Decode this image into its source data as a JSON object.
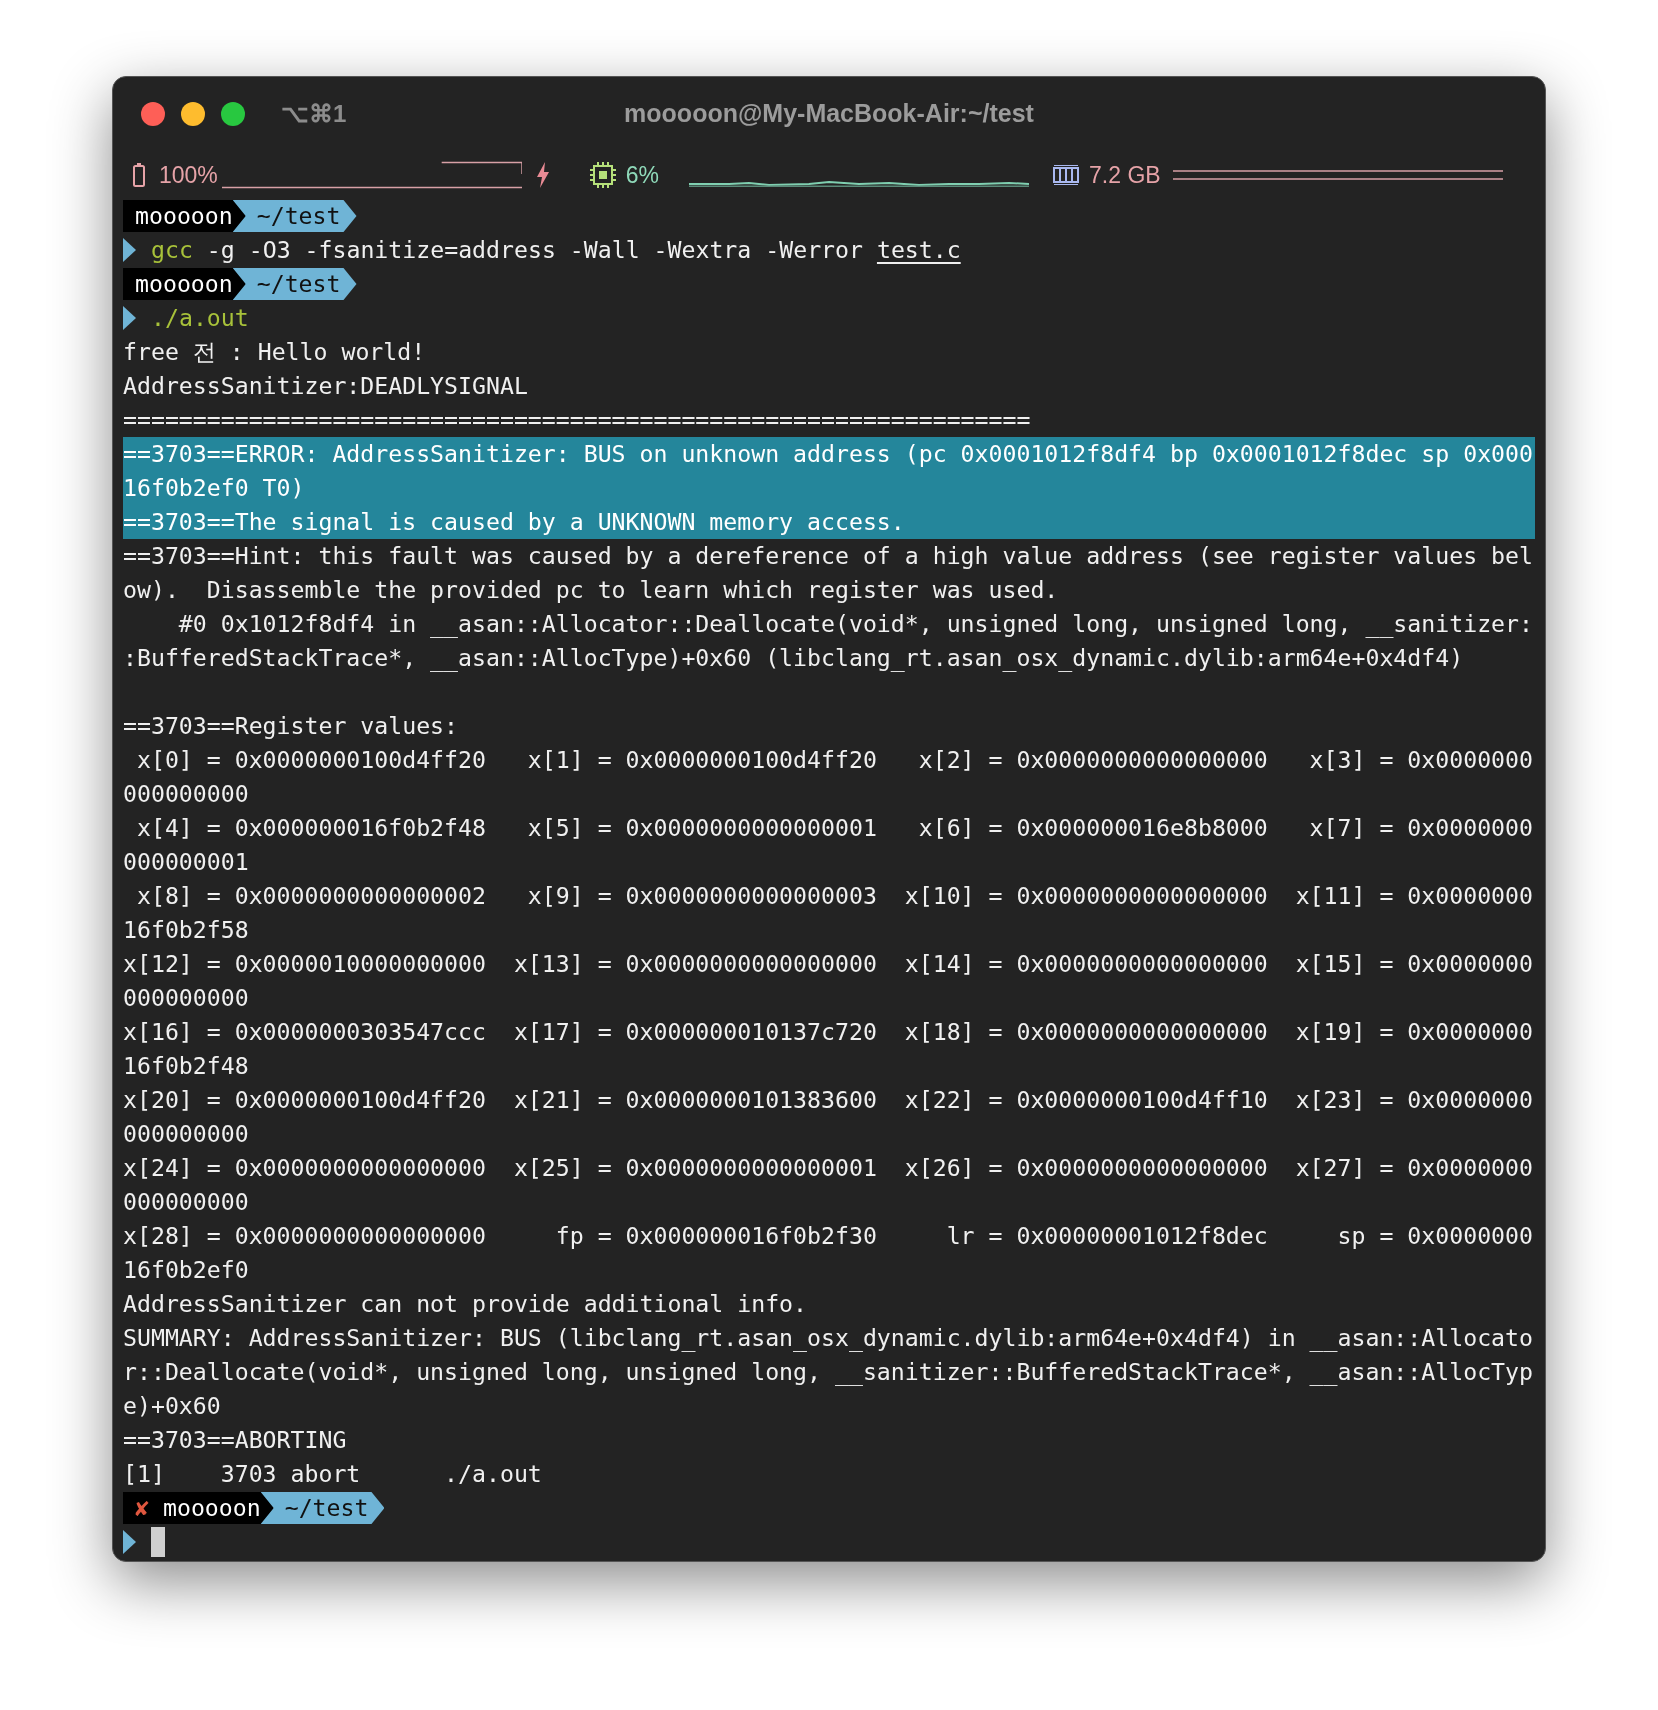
{
  "window": {
    "title": "mooooon@My-MacBook-Air:~/test",
    "shortcut": "⌥⌘1"
  },
  "status_bar": {
    "battery": "100%",
    "cpu": "6%",
    "memory": "7.2 GB"
  },
  "lines": [
    {
      "kind": "prompt",
      "user": "mooooon",
      "path": "~/test"
    },
    {
      "kind": "command",
      "parts": [
        {
          "kind": "program",
          "text": "gcc"
        },
        {
          "kind": "arg",
          "text": " -g -O3 -fsanitize=address -Wall -Wextra -Werror "
        },
        {
          "kind": "file",
          "text": "test.c"
        }
      ]
    },
    {
      "kind": "prompt",
      "user": "mooooon",
      "path": "~/test"
    },
    {
      "kind": "command",
      "parts": [
        {
          "kind": "program",
          "text": "./a.out"
        }
      ]
    },
    {
      "kind": "output",
      "text": "free 전 : Hello world!",
      "selected": false
    },
    {
      "kind": "output",
      "text": "AddressSanitizer:DEADLYSIGNAL",
      "selected": false
    },
    {
      "kind": "output",
      "text": "=================================================================",
      "selected": false
    },
    {
      "kind": "output",
      "text": "==3703==ERROR: AddressSanitizer: BUS on unknown address (pc 0x0001012f8df4 bp 0x0001012f8dec sp 0x000",
      "selected": true
    },
    {
      "kind": "output",
      "text": "16f0b2ef0 T0)",
      "selected": true
    },
    {
      "kind": "output",
      "text": "==3703==The signal is caused by a UNKNOWN memory access.",
      "selected": true
    },
    {
      "kind": "output",
      "text": "==3703==Hint: this fault was caused by a dereference of a high value address (see register values bel",
      "selected": false
    },
    {
      "kind": "output",
      "text": "ow).  Disassemble the provided pc to learn which register was used.",
      "selected": false
    },
    {
      "kind": "output",
      "text": "    #0 0x1012f8df4 in __asan::Allocator::Deallocate(void*, unsigned long, unsigned long, __sanitizer:",
      "selected": false
    },
    {
      "kind": "output",
      "text": ":BufferedStackTrace*, __asan::AllocType)+0x60 (libclang_rt.asan_osx_dynamic.dylib:arm64e+0x4df4)",
      "selected": false
    },
    {
      "kind": "blank"
    },
    {
      "kind": "output",
      "text": "==3703==Register values:",
      "selected": false
    },
    {
      "kind": "output",
      "text": " x[0] = 0x0000000100d4ff20   x[1] = 0x0000000100d4ff20   x[2] = 0x0000000000000000   x[3] = 0x0000000",
      "selected": false
    },
    {
      "kind": "output",
      "text": "000000000",
      "selected": false
    },
    {
      "kind": "output",
      "text": " x[4] = 0x000000016f0b2f48   x[5] = 0x0000000000000001   x[6] = 0x000000016e8b8000   x[7] = 0x0000000",
      "selected": false
    },
    {
      "kind": "output",
      "text": "000000001",
      "selected": false
    },
    {
      "kind": "output",
      "text": " x[8] = 0x0000000000000002   x[9] = 0x0000000000000003  x[10] = 0x0000000000000000  x[11] = 0x0000000",
      "selected": false
    },
    {
      "kind": "output",
      "text": "16f0b2f58",
      "selected": false
    },
    {
      "kind": "output",
      "text": "x[12] = 0x0000010000000000  x[13] = 0x0000000000000000  x[14] = 0x0000000000000000  x[15] = 0x0000000",
      "selected": false
    },
    {
      "kind": "output",
      "text": "000000000",
      "selected": false
    },
    {
      "kind": "output",
      "text": "x[16] = 0x0000000303547ccc  x[17] = 0x000000010137c720  x[18] = 0x0000000000000000  x[19] = 0x0000000",
      "selected": false
    },
    {
      "kind": "output",
      "text": "16f0b2f48",
      "selected": false
    },
    {
      "kind": "output",
      "text": "x[20] = 0x0000000100d4ff20  x[21] = 0x0000000101383600  x[22] = 0x0000000100d4ff10  x[23] = 0x0000000",
      "selected": false
    },
    {
      "kind": "output",
      "text": "000000000",
      "selected": false
    },
    {
      "kind": "output",
      "text": "x[24] = 0x0000000000000000  x[25] = 0x0000000000000001  x[26] = 0x0000000000000000  x[27] = 0x0000000",
      "selected": false
    },
    {
      "kind": "output",
      "text": "000000000",
      "selected": false
    },
    {
      "kind": "output",
      "text": "x[28] = 0x0000000000000000     fp = 0x000000016f0b2f30     lr = 0x00000001012f8dec     sp = 0x0000000",
      "selected": false
    },
    {
      "kind": "output",
      "text": "16f0b2ef0",
      "selected": false
    },
    {
      "kind": "output",
      "text": "AddressSanitizer can not provide additional info.",
      "selected": false
    },
    {
      "kind": "output",
      "text": "SUMMARY: AddressSanitizer: BUS (libclang_rt.asan_osx_dynamic.dylib:arm64e+0x4df4) in __asan::Allocato",
      "selected": false
    },
    {
      "kind": "output",
      "text": "r::Deallocate(void*, unsigned long, unsigned long, __sanitizer::BufferedStackTrace*, __asan::AllocTyp",
      "selected": false
    },
    {
      "kind": "output",
      "text": "e)+0x60",
      "selected": false
    },
    {
      "kind": "output",
      "text": "==3703==ABORTING",
      "selected": false
    },
    {
      "kind": "output",
      "text": "[1]    3703 abort      ./a.out",
      "selected": false
    },
    {
      "kind": "prompt",
      "mark": "✘",
      "user": "mooooon",
      "path": "~/test"
    },
    {
      "kind": "cursor"
    }
  ]
}
